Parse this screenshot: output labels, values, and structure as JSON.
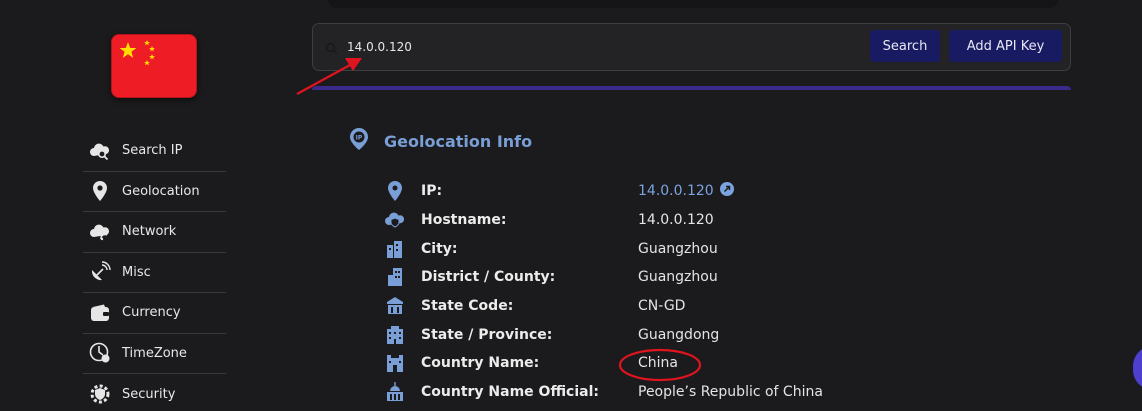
{
  "search": {
    "value": "14.0.0.120",
    "search_label": "Search",
    "api_label": "Add API Key"
  },
  "sidebar": {
    "items": [
      {
        "label": "Search IP",
        "icon": "cloud-search-icon"
      },
      {
        "label": "Geolocation",
        "icon": "map-pin-icon"
      },
      {
        "label": "Network",
        "icon": "cloud-network-icon"
      },
      {
        "label": "Misc",
        "icon": "satellite-dish-icon"
      },
      {
        "label": "Currency",
        "icon": "wallet-icon"
      },
      {
        "label": "TimeZone",
        "icon": "clock-globe-icon"
      },
      {
        "label": "Security",
        "icon": "shield-gear-icon"
      }
    ]
  },
  "section": {
    "title": "Geolocation Info"
  },
  "rows": [
    {
      "label": "IP:",
      "value": "14.0.0.120",
      "link": true,
      "icon": "map-pin-icon"
    },
    {
      "label": "Hostname:",
      "value": "14.0.0.120",
      "icon": "cloud-shield-icon"
    },
    {
      "label": "City:",
      "value": "Guangzhou",
      "icon": "city-icon"
    },
    {
      "label": "District / County:",
      "value": "Guangzhou",
      "icon": "building-icon"
    },
    {
      "label": "State Code:",
      "value": "CN-GD",
      "icon": "government-building-icon"
    },
    {
      "label": "State / Province:",
      "value": "Guangdong",
      "icon": "office-building-icon"
    },
    {
      "label": "Country Name:",
      "value": "China",
      "icon": "castle-icon"
    },
    {
      "label": "Country Name Official:",
      "value": "People’s Republic of China",
      "icon": "capitol-icon"
    }
  ],
  "colors": {
    "accent": "#7a9ed6",
    "button_bg": "#181a62",
    "annotation": "#e0141e",
    "flag_red": "#ee1c25",
    "flag_star": "#ffde00"
  }
}
